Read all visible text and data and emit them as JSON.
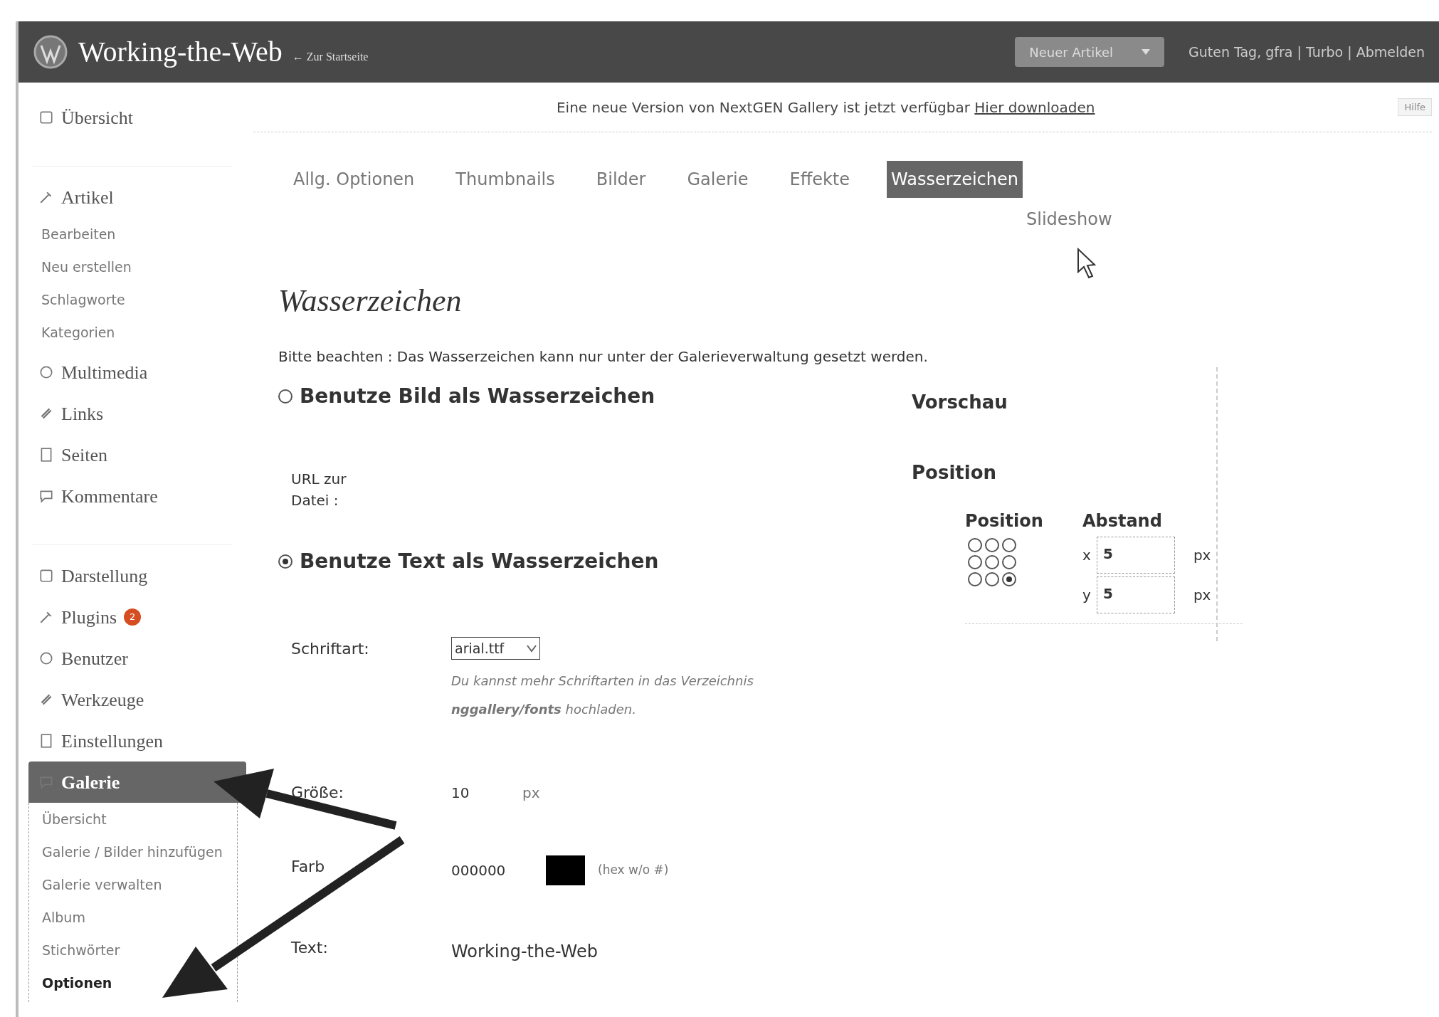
{
  "header": {
    "site_title": "Working-the-Web",
    "home_link": "← Zur Startseite",
    "new_button": "Neuer Artikel",
    "user_links": "Guten Tag, gfra | Turbo | Abmelden"
  },
  "notice": {
    "text": "Eine neue Version von NextGEN Gallery ist jetzt verfügbar",
    "link": "Hier downloaden",
    "help": "Hilfe"
  },
  "sidebar": {
    "items": [
      {
        "label": "Übersicht",
        "selected": false
      },
      {
        "kind": "separator"
      },
      {
        "label": "Artikel",
        "selected": false,
        "expanded": true,
        "children": [
          {
            "label": "Bearbeiten",
            "selected": false
          },
          {
            "label": "Neu erstellen",
            "selected": false
          },
          {
            "label": "Schlagworte",
            "selected": false
          },
          {
            "label": "Kategorien",
            "selected": false
          }
        ]
      },
      {
        "label": "Multimedia",
        "selected": false
      },
      {
        "label": "Links",
        "selected": false
      },
      {
        "label": "Seiten",
        "selected": false
      },
      {
        "label": "Kommentare",
        "selected": false
      },
      {
        "kind": "separator"
      },
      {
        "label": "Darstellung",
        "selected": false
      },
      {
        "label": "Plugins",
        "selected": false,
        "badge": "2"
      },
      {
        "label": "Benutzer",
        "selected": false
      },
      {
        "label": "Werkzeuge",
        "selected": false
      },
      {
        "label": "Einstellungen",
        "selected": false
      },
      {
        "label": "Galerie",
        "selected": true,
        "expanded": true,
        "children": [
          {
            "label": "Übersicht",
            "selected": false
          },
          {
            "label": "Galerie / Bilder hinzufügen",
            "selected": false
          },
          {
            "label": "Galerie verwalten",
            "selected": false
          },
          {
            "label": "Album",
            "selected": false
          },
          {
            "label": "Stichwörter",
            "selected": false
          },
          {
            "label": "Optionen",
            "selected": true
          }
        ]
      }
    ]
  },
  "tabs": [
    {
      "label": "Allg. Optionen",
      "selected": false
    },
    {
      "label": "Thumbnails",
      "selected": false
    },
    {
      "label": "Bilder",
      "selected": false
    },
    {
      "label": "Galerie",
      "selected": false
    },
    {
      "label": "Effekte",
      "selected": false
    },
    {
      "label": "Wasserzeichen",
      "selected": true
    },
    {
      "label": "Slideshow",
      "selected": false
    }
  ],
  "heading": "Wasserzeichen",
  "note": "Bitte beachten : Das Wasserzeichen kann nur unter der Galerieverwaltung gesetzt werden.",
  "image_option": {
    "label": "Benutze Bild als Wasserzeichen",
    "selected": false,
    "url_label": "URL zur Datei :"
  },
  "text_option": {
    "label": "Benutze Text als Wasserzeichen",
    "selected": true
  },
  "font": {
    "label": "Schriftart:",
    "value": "arial.ttf",
    "hint": "Du kannst mehr Schriftarten in das Verzeichnis **nggallery/fonts** hochladen."
  },
  "size": {
    "label": "Größe:",
    "value": "10",
    "unit": "px"
  },
  "color": {
    "label": "Farb",
    "value": "000000",
    "color": "#000000",
    "hint": "(hex w/o #)"
  },
  "text": {
    "label": "Text:",
    "value": "Working-the-Web"
  },
  "preview": {
    "title": "Vorschau",
    "position_title": "Position",
    "grid_label": "Position",
    "offset_label": "Abstand",
    "grid": [
      {
        "selected": false
      },
      {
        "selected": false
      },
      {
        "selected": false
      },
      {
        "selected": false
      },
      {
        "selected": false
      },
      {
        "selected": false
      },
      {
        "selected": false
      },
      {
        "selected": false
      },
      {
        "selected": true
      }
    ],
    "offsets": [
      {
        "axis": "x",
        "value": "5",
        "unit": "px"
      },
      {
        "axis": "y",
        "value": "5",
        "unit": "px"
      }
    ]
  }
}
